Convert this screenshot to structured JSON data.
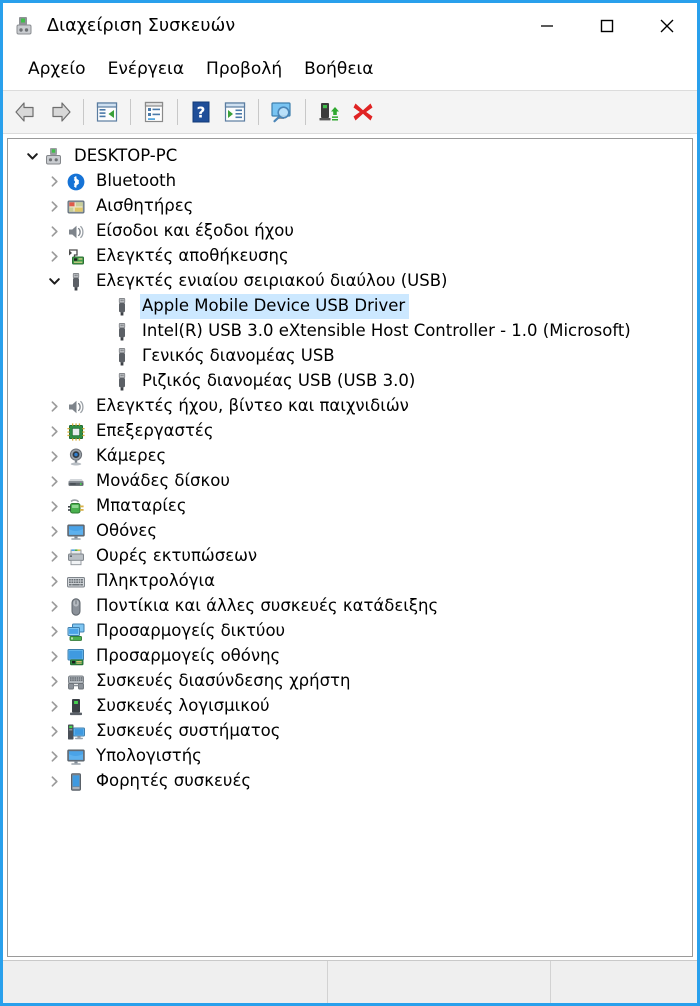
{
  "window": {
    "title": "Διαχείριση Συσκευών",
    "app_icon": "device-manager-icon",
    "border_color": "#29a0ec",
    "controls": {
      "minimize": "minimize-icon",
      "maximize": "maximize-icon",
      "close": "close-icon"
    }
  },
  "menubar": {
    "items": [
      {
        "label": "Αρχείο"
      },
      {
        "label": "Ενέργεια"
      },
      {
        "label": "Προβολή"
      },
      {
        "label": "Βοήθεια"
      }
    ]
  },
  "toolbar": {
    "buttons": [
      {
        "name": "back-button",
        "icon": "back-arrow-icon"
      },
      {
        "name": "forward-button",
        "icon": "forward-arrow-icon"
      },
      {
        "name": "separator-1",
        "icon": "separator"
      },
      {
        "name": "show-hide-console-tree-button",
        "icon": "console-tree-icon"
      },
      {
        "name": "separator-2",
        "icon": "separator"
      },
      {
        "name": "properties-button",
        "icon": "properties-icon"
      },
      {
        "name": "separator-3",
        "icon": "separator"
      },
      {
        "name": "help-button",
        "icon": "help-question-icon"
      },
      {
        "name": "update-driver-button",
        "icon": "update-driver-icon"
      },
      {
        "name": "separator-4",
        "icon": "separator"
      },
      {
        "name": "scan-for-hardware-changes-button",
        "icon": "scan-hardware-icon"
      },
      {
        "name": "separator-5",
        "icon": "separator"
      },
      {
        "name": "enable-device-button",
        "icon": "enable-device-icon"
      },
      {
        "name": "uninstall-device-button",
        "icon": "red-x-icon"
      }
    ]
  },
  "tree": {
    "selection_color": "#cce8ff",
    "nodes": [
      {
        "label": "DESKTOP-PC",
        "level": 0,
        "state": "expanded",
        "icon": "computer-icon"
      },
      {
        "label": "Bluetooth",
        "level": 1,
        "state": "collapsed",
        "icon": "bluetooth-icon"
      },
      {
        "label": "Αισθητήρες",
        "level": 1,
        "state": "collapsed",
        "icon": "sensors-icon"
      },
      {
        "label": "Είσοδοι και έξοδοι ήχου",
        "level": 1,
        "state": "collapsed",
        "icon": "audio-io-icon"
      },
      {
        "label": "Ελεγκτές αποθήκευσης",
        "level": 1,
        "state": "collapsed",
        "icon": "storage-controller-icon"
      },
      {
        "label": "Ελεγκτές ενιαίου σειριακού διαύλου (USB)",
        "level": 1,
        "state": "expanded",
        "icon": "usb-icon"
      },
      {
        "label": "Apple Mobile Device USB Driver",
        "level": 2,
        "state": "leaf",
        "icon": "usb-device-icon",
        "selected": true
      },
      {
        "label": "Intel(R) USB 3.0 eXtensible Host Controller - 1.0 (Microsoft)",
        "level": 2,
        "state": "leaf",
        "icon": "usb-device-icon"
      },
      {
        "label": "Γενικός διανομέας USB",
        "level": 2,
        "state": "leaf",
        "icon": "usb-device-icon"
      },
      {
        "label": "Ριζικός διανομέας USB (USB 3.0)",
        "level": 2,
        "state": "leaf",
        "icon": "usb-device-icon"
      },
      {
        "label": "Ελεγκτές ήχου, βίντεο και παιχνιδιών",
        "level": 1,
        "state": "collapsed",
        "icon": "audio-io-icon"
      },
      {
        "label": "Επεξεργαστές",
        "level": 1,
        "state": "collapsed",
        "icon": "processor-icon"
      },
      {
        "label": "Κάμερες",
        "level": 1,
        "state": "collapsed",
        "icon": "camera-icon"
      },
      {
        "label": "Μονάδες δίσκου",
        "level": 1,
        "state": "collapsed",
        "icon": "disk-drive-icon"
      },
      {
        "label": "Μπαταρίες",
        "level": 1,
        "state": "collapsed",
        "icon": "battery-icon"
      },
      {
        "label": "Οθόνες",
        "level": 1,
        "state": "collapsed",
        "icon": "monitor-icon"
      },
      {
        "label": "Ουρές εκτυπώσεων",
        "level": 1,
        "state": "collapsed",
        "icon": "printer-icon"
      },
      {
        "label": "Πληκτρολόγια",
        "level": 1,
        "state": "collapsed",
        "icon": "keyboard-icon"
      },
      {
        "label": "Ποντίκια και άλλες συσκευές κατάδειξης",
        "level": 1,
        "state": "collapsed",
        "icon": "mouse-icon"
      },
      {
        "label": "Προσαρμογείς δικτύου",
        "level": 1,
        "state": "collapsed",
        "icon": "network-adapter-icon"
      },
      {
        "label": "Προσαρμογείς οθόνης",
        "level": 1,
        "state": "collapsed",
        "icon": "display-adapter-icon"
      },
      {
        "label": "Συσκευές διασύνδεσης χρήστη",
        "level": 1,
        "state": "collapsed",
        "icon": "hid-icon"
      },
      {
        "label": "Συσκευές λογισμικού",
        "level": 1,
        "state": "collapsed",
        "icon": "software-device-icon"
      },
      {
        "label": "Συσκευές συστήματος",
        "level": 1,
        "state": "collapsed",
        "icon": "system-device-icon"
      },
      {
        "label": "Υπολογιστής",
        "level": 1,
        "state": "collapsed",
        "icon": "monitor-icon"
      },
      {
        "label": "Φορητές συσκευές",
        "level": 1,
        "state": "collapsed",
        "icon": "portable-device-icon"
      }
    ]
  },
  "statusbar": {
    "cells": [
      "",
      "",
      ""
    ]
  }
}
